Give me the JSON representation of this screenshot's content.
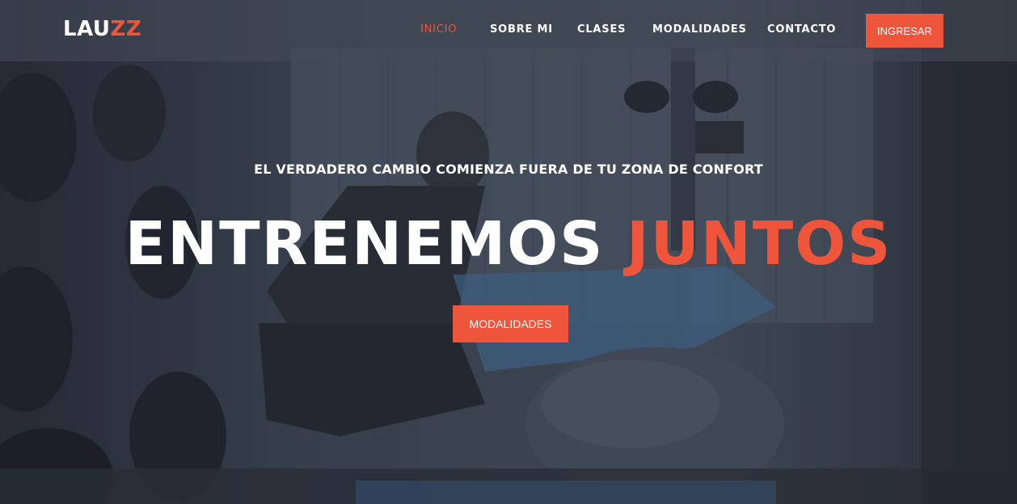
{
  "brand": {
    "logo_main": "LAU",
    "logo_accent": "ZZ"
  },
  "nav": {
    "items": [
      {
        "label": "INICIO",
        "active": true
      },
      {
        "label": "SOBRE MI",
        "active": false
      },
      {
        "label": "CLASES",
        "active": false
      },
      {
        "label": "MODALIDADES",
        "active": false
      },
      {
        "label": "CONTACTO",
        "active": false
      }
    ],
    "login_button": "INGRESAR"
  },
  "hero": {
    "tagline": "EL VERDADERO CAMBIO COMIENZA FUERA DE TU ZONA DE CONFORT",
    "headline_main": "ENTRENEMOS ",
    "headline_accent": "JUNTOS",
    "cta_button": "MODALIDADES"
  },
  "colors": {
    "accent": "#ef553b",
    "text": "#ffffff",
    "navbar_bg": "rgba(70,76,88,0.55)",
    "overlay": "#2f3540"
  }
}
